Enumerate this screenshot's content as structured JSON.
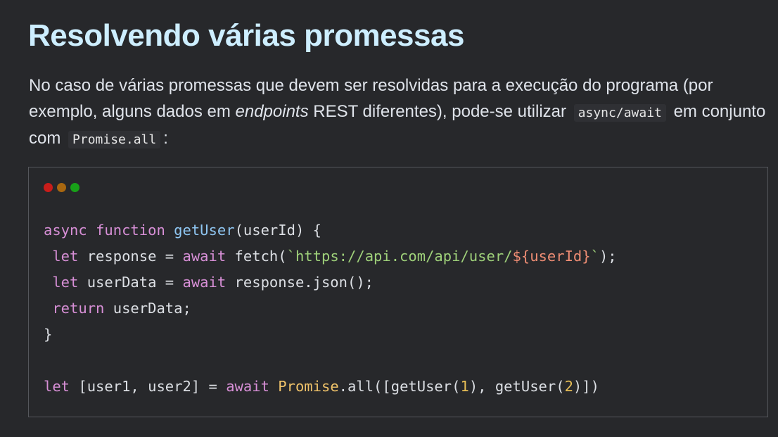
{
  "heading": "Resolvendo várias promessas",
  "paragraph": {
    "text1": "No caso de várias promessas que devem ser resolvidas para a execução do programa (por exemplo, alguns dados em ",
    "emphasis": "endpoints",
    "text2": " REST diferentes), pode-se utilizar",
    "code1": "async/await",
    "text3": "em conjunto com",
    "code2": "Promise.all",
    "text4": ":"
  },
  "window_controls": {
    "red": "#c81d1a",
    "yellow": "#a86710",
    "green": "#18a018"
  },
  "code": {
    "l1": {
      "async": "async",
      "function": "function",
      "name": "getUser",
      "rest": "(userId) {"
    },
    "l2": {
      "indent": " ",
      "let": "let",
      "mid": " response = ",
      "await": "await",
      "call": " fetch(",
      "str_open": "`https://api.com/api/user/",
      "interp": "${userId}",
      "str_close": "`",
      "end": ");"
    },
    "l3": {
      "indent": " ",
      "let": "let",
      "mid": " userData = ",
      "await": "await",
      "rest": " response.json();"
    },
    "l4": {
      "indent": " ",
      "return": "return",
      "rest": " userData;"
    },
    "l5": {
      "text": "}"
    },
    "l6": {
      "let": "let",
      "a": " [user1, user2] = ",
      "await": "await",
      "sp": " ",
      "cls": "Promise",
      "b": ".all([getUser(",
      "n1": "1",
      "c": "), getUser(",
      "n2": "2",
      "d": ")])"
    }
  }
}
